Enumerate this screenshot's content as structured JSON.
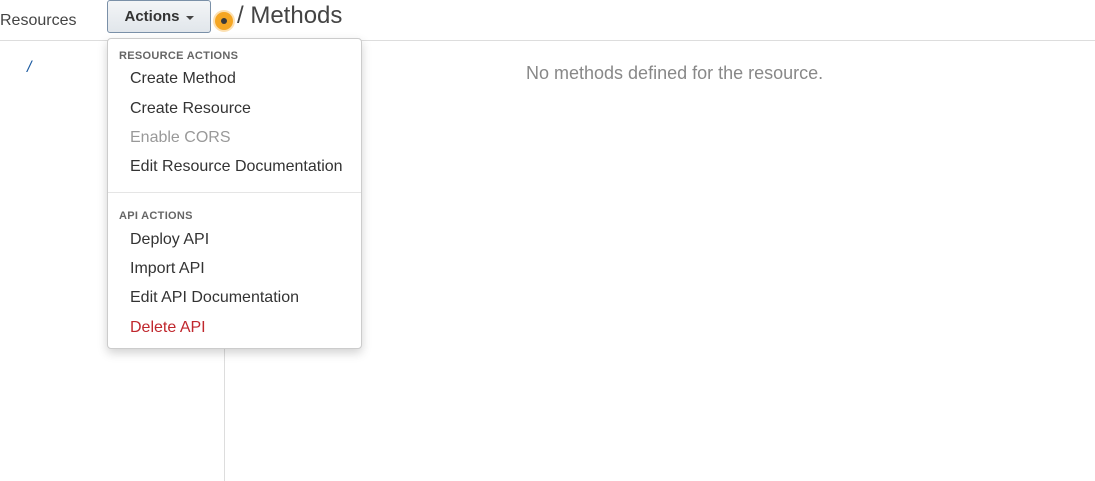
{
  "header": {
    "resources_label": "Resources",
    "actions_label": "Actions",
    "page_title": "/ Methods"
  },
  "tree": {
    "root_label": "/"
  },
  "main": {
    "empty_message": "No methods defined for the resource."
  },
  "menu": {
    "resource_actions_header": "RESOURCE ACTIONS",
    "resource_actions": [
      {
        "label": "Create Method",
        "enabled": true
      },
      {
        "label": "Create Resource",
        "enabled": true
      },
      {
        "label": "Enable CORS",
        "enabled": false
      },
      {
        "label": "Edit Resource Documentation",
        "enabled": true
      }
    ],
    "api_actions_header": "API ACTIONS",
    "api_actions": [
      {
        "label": "Deploy API"
      },
      {
        "label": "Import API"
      },
      {
        "label": "Edit API Documentation"
      },
      {
        "label": "Delete API",
        "style": "danger"
      }
    ]
  },
  "colors": {
    "link": "#1a5aa0",
    "danger": "#c0272d",
    "disabled": "#999999",
    "cursor_highlight": "#f5a623"
  }
}
